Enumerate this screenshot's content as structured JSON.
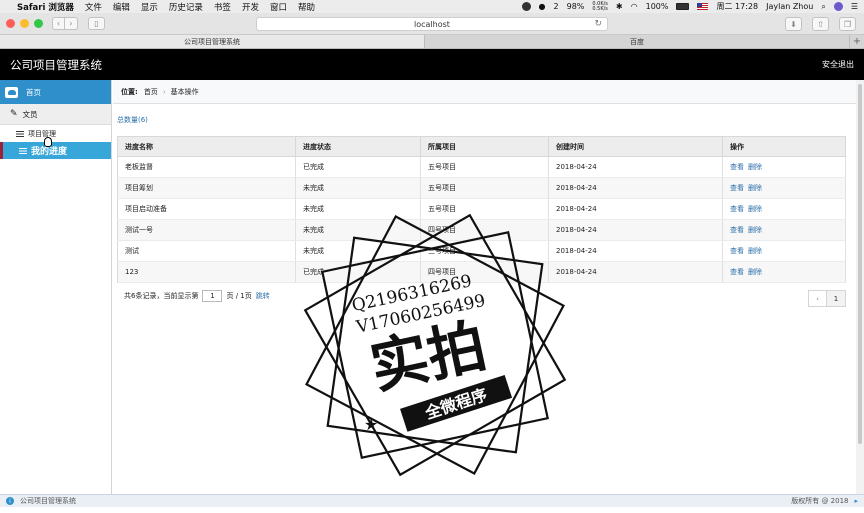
{
  "menubar": {
    "app_name": "Safari 浏览器",
    "menus": [
      "文件",
      "编辑",
      "显示",
      "历史记录",
      "书签",
      "开发",
      "窗口",
      "帮助"
    ],
    "status": {
      "notif_count": "2",
      "cpu": "98%",
      "net_up": "0.0K/s",
      "net_down": "0.5K/s",
      "battery": "100%",
      "clock": "周二 17:28",
      "user": "Jaylan Zhou"
    }
  },
  "browser": {
    "url": "localhost",
    "tabs": [
      {
        "label": "公司项目管理系统",
        "active": true
      },
      {
        "label": "百度",
        "active": false
      }
    ]
  },
  "header": {
    "title": "公司项目管理系统",
    "logout": "安全退出"
  },
  "sidebar": {
    "home": "首页",
    "group": "文员",
    "items": [
      {
        "label": "项目管理",
        "active": false
      },
      {
        "label": "我的进度",
        "active": true
      }
    ]
  },
  "breadcrumb": {
    "label": "位置:",
    "home": "首页",
    "current": "基本操作"
  },
  "summary": {
    "total_label": "总数量(6)"
  },
  "table": {
    "columns": [
      "进度名称",
      "进度状态",
      "所属项目",
      "创建时间",
      "操作"
    ],
    "rows": [
      {
        "name": "老板监督",
        "status": "已完成",
        "project": "五号项目",
        "created": "2018-04-24"
      },
      {
        "name": "项目筹划",
        "status": "未完成",
        "project": "五号项目",
        "created": "2018-04-24"
      },
      {
        "name": "项目启动准备",
        "status": "未完成",
        "project": "五号项目",
        "created": "2018-04-24"
      },
      {
        "name": "测试一号",
        "status": "未完成",
        "project": "四号项目",
        "created": "2018-04-24"
      },
      {
        "name": "测试",
        "status": "未完成",
        "project": "三号项目",
        "created": "2018-04-24"
      },
      {
        "name": "123",
        "status": "已完成",
        "project": "四号项目",
        "created": "2018-04-24"
      }
    ],
    "view_label": "查看",
    "delete_label": "删除"
  },
  "pagination": {
    "summary_prefix": "共6条记录，",
    "current_prefix": "当前显示第",
    "page_value": "1",
    "page_suffix": "页 / 1页",
    "jump": "跳转",
    "prev": "‹",
    "current_page": "1"
  },
  "footer": {
    "app_name": "公司项目管理系统",
    "copyright": "版权所有 @ 2018"
  },
  "watermark": {
    "line1": "Q2196316269",
    "line2": "V17060256499",
    "main": "实拍",
    "banner": "全微程序"
  }
}
